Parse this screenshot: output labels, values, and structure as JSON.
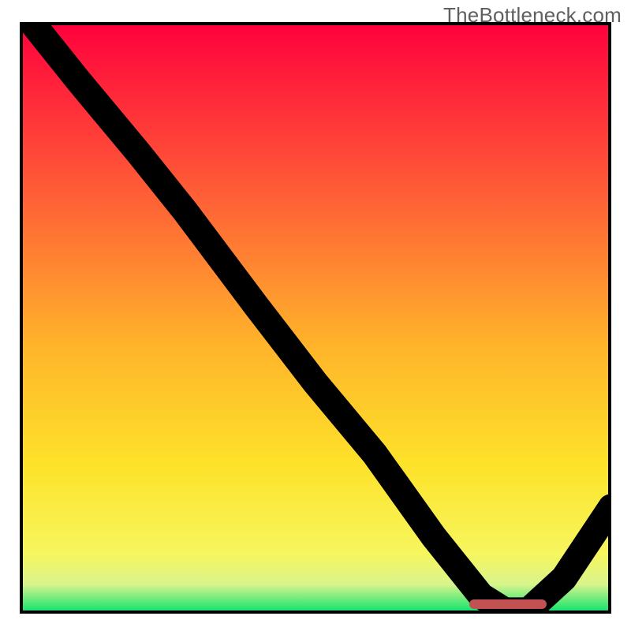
{
  "watermark": "TheBottleneck.com",
  "colors": {
    "frame": "#000000",
    "curve": "#000000",
    "marker": "#c25151"
  },
  "chart_data": {
    "type": "line",
    "title": "",
    "xlabel": "",
    "ylabel": "",
    "xlim": [
      0,
      100
    ],
    "ylim": [
      0,
      100
    ],
    "grid": false,
    "legend": false,
    "gradient_bands": [
      {
        "y0": 0,
        "y1": 30,
        "c0": "#ff003d",
        "c1": "#ff6136"
      },
      {
        "y0": 30,
        "y1": 55,
        "c0": "#ff6136",
        "c1": "#ffb52a"
      },
      {
        "y0": 55,
        "y1": 75,
        "c0": "#ffb52a",
        "c1": "#fde32a"
      },
      {
        "y0": 75,
        "y1": 90,
        "c0": "#fde32a",
        "c1": "#f6f65f"
      },
      {
        "y0": 90,
        "y1": 95,
        "c0": "#f6f65f",
        "c1": "#d9f48c"
      },
      {
        "y0": 95,
        "y1": 100,
        "c0": "#d9f48c",
        "c1": "#00e36b"
      }
    ],
    "series": [
      {
        "name": "bottleneck-curve",
        "x": [
          2,
          10,
          20,
          28,
          40,
          50,
          60,
          70,
          78,
          82,
          86,
          92,
          100
        ],
        "y": [
          100,
          90,
          78,
          68,
          52,
          39,
          27,
          13,
          3,
          0.5,
          0.5,
          6,
          18
        ]
      }
    ],
    "annotations": [
      {
        "name": "sweet-spot-marker",
        "x0": 76,
        "x1": 89,
        "y": 0.8
      }
    ]
  }
}
